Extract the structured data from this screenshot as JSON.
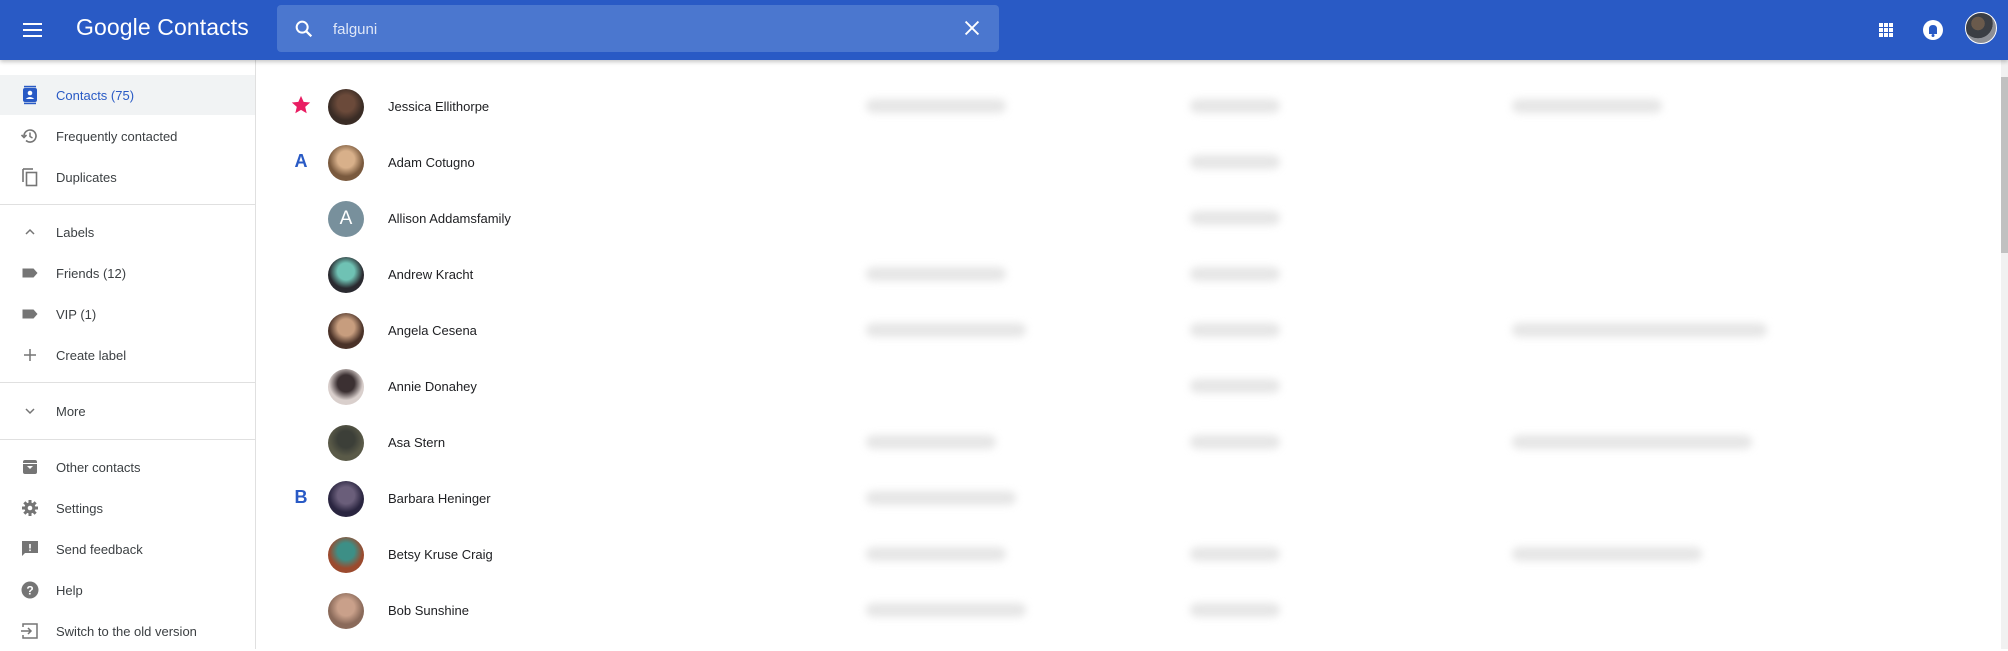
{
  "header": {
    "app_title": "Google Contacts",
    "search": {
      "value": "falguni",
      "placeholder": "Search"
    },
    "brand_color": "#295ac5"
  },
  "sidebar": {
    "items": [
      {
        "label": "Contacts (75)",
        "icon": "contacts-icon",
        "active": true
      },
      {
        "label": "Frequently contacted",
        "icon": "history-icon"
      },
      {
        "label": "Duplicates",
        "icon": "duplicates-icon"
      }
    ],
    "labels_header": "Labels",
    "labels": [
      {
        "label": "Friends (12)",
        "icon": "label-icon"
      },
      {
        "label": "VIP (1)",
        "icon": "label-icon"
      }
    ],
    "create_label": "Create label",
    "more": "More",
    "bottom": [
      {
        "label": "Other contacts",
        "icon": "archive-icon"
      },
      {
        "label": "Settings",
        "icon": "gear-icon"
      },
      {
        "label": "Send feedback",
        "icon": "feedback-icon"
      },
      {
        "label": "Help",
        "icon": "help-icon"
      },
      {
        "label": "Switch to the old version",
        "icon": "exit-icon"
      }
    ]
  },
  "contacts": [
    {
      "name": "Jessica Ellithorpe",
      "marker": "star",
      "avatar": "photo",
      "email": true,
      "phone": true,
      "notes": true
    },
    {
      "name": "Adam Cotugno",
      "marker": "A",
      "avatar": "photo",
      "email": false,
      "phone": true,
      "notes": false
    },
    {
      "name": "Allison Addamsfamily",
      "marker": "",
      "avatar": "A",
      "email": false,
      "phone": true,
      "notes": false
    },
    {
      "name": "Andrew Kracht",
      "marker": "",
      "avatar": "photo",
      "email": true,
      "phone": true,
      "notes": false
    },
    {
      "name": "Angela Cesena",
      "marker": "",
      "avatar": "photo",
      "email": true,
      "phone": true,
      "notes": true
    },
    {
      "name": "Annie Donahey",
      "marker": "",
      "avatar": "photo",
      "email": false,
      "phone": true,
      "notes": false
    },
    {
      "name": "Asa Stern",
      "marker": "",
      "avatar": "photo",
      "email": true,
      "phone": true,
      "notes": true
    },
    {
      "name": "Barbara Heninger",
      "marker": "B",
      "avatar": "photo",
      "email": true,
      "phone": false,
      "notes": false
    },
    {
      "name": "Betsy Kruse Craig",
      "marker": "",
      "avatar": "photo",
      "email": true,
      "phone": true,
      "notes": true
    },
    {
      "name": "Bob Sunshine",
      "marker": "",
      "avatar": "photo",
      "email": true,
      "phone": true,
      "notes": false
    }
  ],
  "colors": {
    "star": "#e91e63",
    "section_letter": "#295ac5",
    "letter_avatar": "#78909c"
  }
}
